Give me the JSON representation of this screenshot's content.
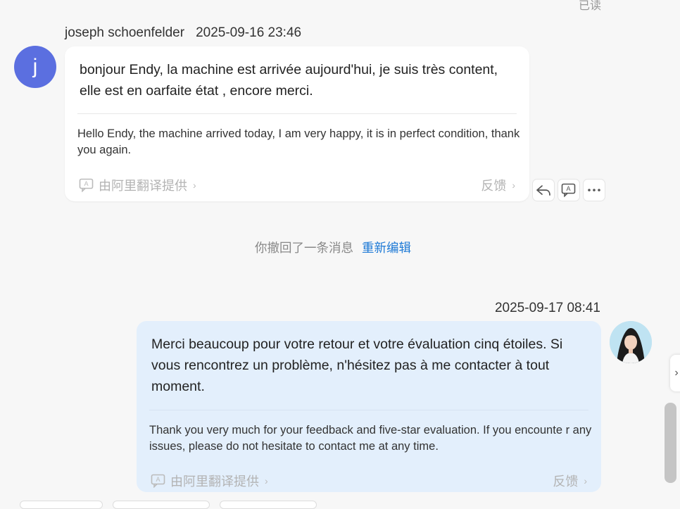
{
  "read_status": "已读",
  "incoming": {
    "sender": "joseph schoenfelder",
    "timestamp": "2025-09-16 23:46",
    "avatar_letter": "j",
    "text": "bonjour Endy, la machine est arrivée aujourd'hui, je suis très content, elle est en oarfaite état , encore merci.",
    "translation": "Hello Endy, the machine arrived today, I am very happy, it is in perfect condition, thank you again.",
    "translation_credit": "由阿里翻译提供",
    "feedback_label": "反馈"
  },
  "recall_notice": {
    "text": "你撤回了一条消息",
    "action": "重新编辑"
  },
  "outgoing": {
    "timestamp": "2025-09-17 08:41",
    "text": "Merci beaucoup pour votre retour et votre évaluation cinq étoiles. Si vous rencontrez un problème, n'hésitez pas à me contacter à tout moment.",
    "translation": "Thank you very much for your feedback and five-star evaluation. If you encounte r any issues, please do not hesitate to contact me at any time.",
    "translation_credit": "由阿里翻译提供",
    "feedback_label": "反馈"
  },
  "colors": {
    "accent": "#1e7ad6",
    "avatar_bg": "#5b6fe0",
    "outgoing_bubble": "#e3effc"
  }
}
